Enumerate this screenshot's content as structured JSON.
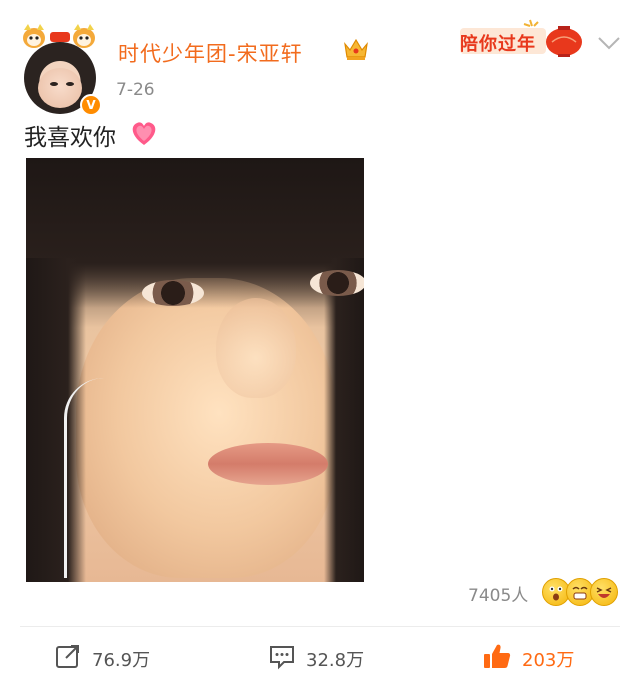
{
  "header": {
    "username": "时代少年团-宋亚轩",
    "timestamp": "7-26",
    "festival_badge": "陪你过年"
  },
  "post": {
    "text": "我喜欢你"
  },
  "reactions": {
    "count": "7405人",
    "emojis": [
      "surprised-emoji-icon",
      "grin-emoji-icon",
      "laugh-emoji-icon"
    ]
  },
  "actions": {
    "share": "76.9万",
    "comment": "32.8万",
    "like": "203万"
  },
  "colors": {
    "username": "#f26b1d",
    "like_active": "#ff6a13",
    "festival_red": "#e8381c"
  }
}
